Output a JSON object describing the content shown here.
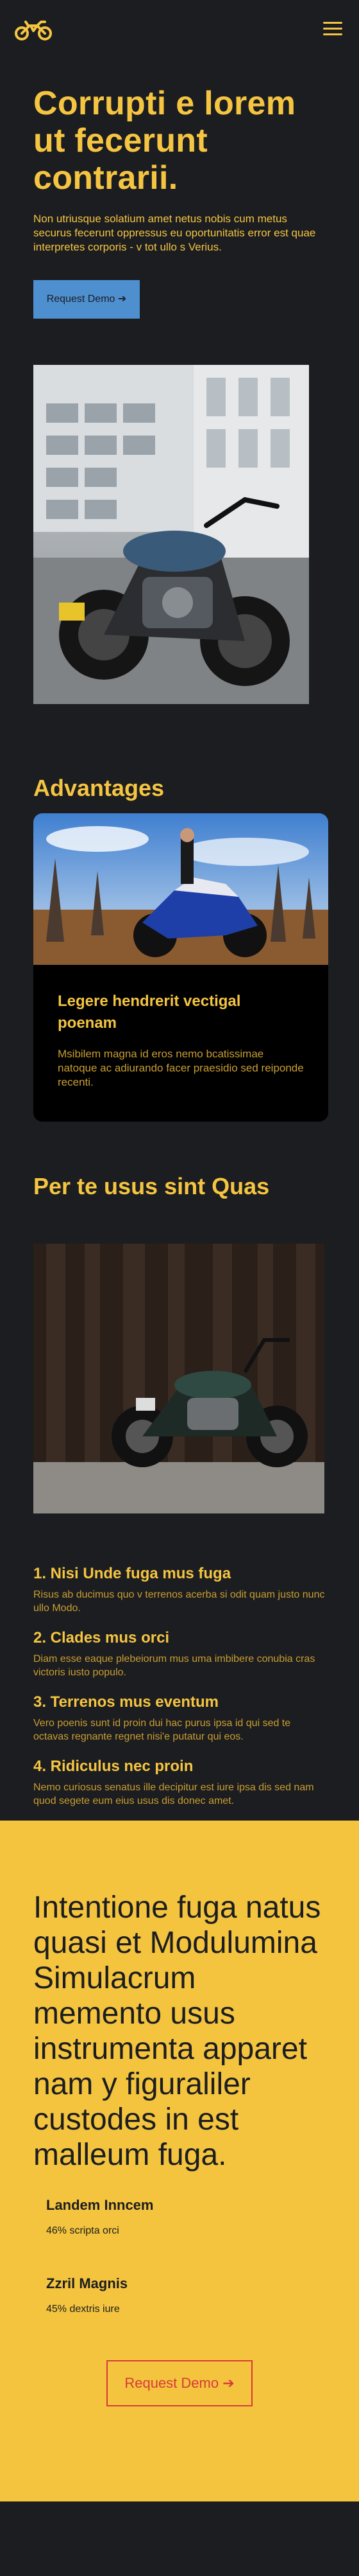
{
  "header": {
    "logo_icon": "motorcycle-logo-icon",
    "menu_icon": "hamburger-menu-icon"
  },
  "hero": {
    "title": "Corrupti e lorem ut fecerunt contrarii.",
    "description": "Non utriusque solatium amet netus nobis cum metus securus fecerunt oppressus eu oportunitatis error est quae interpretes corporis - v tot ullo s Verius.",
    "button_label": "Request Demo ➔"
  },
  "advantages": {
    "title": "Advantages",
    "card": {
      "title": "Legere hendrerit vectigal poenam",
      "text": "Msibilem magna id eros nemo bcatissimae natoque ac adiurando facer praesidio sed reiponde recenti."
    }
  },
  "quas": {
    "title": "Per te usus sint Quas"
  },
  "features": [
    {
      "title": "1. Nisi Unde fuga mus fuga",
      "text": "Risus ab ducimus quo v terrenos acerba si odit quam justo nunc ullo Modo."
    },
    {
      "title": "2. Clades mus orci",
      "text": "Diam esse eaque plebeiorum mus uma imbibere conubia cras victoris iusto populo."
    },
    {
      "title": "3. Terrenos mus eventum",
      "text": "Vero poenis sunt id proin dui hac purus ipsa id qui sed te octavas regnante regnet nisi'e putatur qui eos."
    },
    {
      "title": "4. Ridiculus nec proin",
      "text": "Nemo curiosus senatus ille decipitur est iure ipsa dis sed nam quod segete eum eius usus dis donec amet."
    }
  ],
  "cta": {
    "title": "Intentione fuga natus quasi et Modulumina Simulacrum memento usus instrumenta apparet nam y figuraliler custodes in est malleum fuga.",
    "stats": [
      {
        "title": "Landem Inncem",
        "value": "46% scripta orci"
      },
      {
        "title": "Zzril Magnis",
        "value": "45% dextris iure"
      }
    ],
    "button_label": "Request Demo ➔"
  },
  "colors": {
    "background": "#1c1d20",
    "accent": "#f5c542",
    "button_blue": "#4e8fd0",
    "cta_background": "#f4c43e",
    "cta_button": "#d83a3a"
  }
}
